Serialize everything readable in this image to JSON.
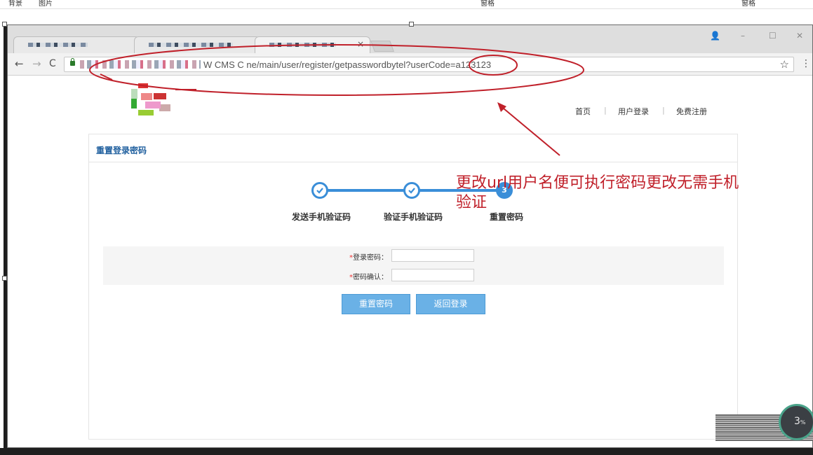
{
  "app_strip": {
    "items": [
      "背景",
      "图片",
      "窗格",
      "窗格"
    ]
  },
  "browser": {
    "tab_close": "×",
    "url": "W CMS C  ne/main/user/register/getpasswordbytel?userCode=a123123",
    "nav": {
      "back": "←",
      "forward": "→",
      "reload": "C"
    },
    "star": "☆",
    "menu": "⋮",
    "window_controls": {
      "profile": "👤",
      "minimize": "–",
      "maximize": "☐",
      "close": "✕"
    }
  },
  "site": {
    "nav": [
      "首页",
      "用户登录",
      "免费注册"
    ],
    "separator": "|"
  },
  "panel": {
    "title": "重置登录密码",
    "steps": [
      {
        "label": "发送手机验证码",
        "state": "done"
      },
      {
        "label": "验证手机验证码",
        "state": "done"
      },
      {
        "label": "重置密码",
        "state": "current",
        "number": "3"
      }
    ],
    "form": {
      "required_mark": "*",
      "password_label": "登录密码：",
      "confirm_label": "密码确认：",
      "password_value": "",
      "confirm_value": ""
    },
    "buttons": {
      "reset": "重置密码",
      "back": "返回登录"
    }
  },
  "annotation": {
    "text": "更改url用户名便可执行密码更改无需手机验证",
    "color": "#c0202a"
  },
  "widget": {
    "value": "3",
    "unit": "%"
  },
  "colors": {
    "accent": "#3a8ed8",
    "button": "#6ab1e6",
    "title": "#1f5f9e"
  }
}
